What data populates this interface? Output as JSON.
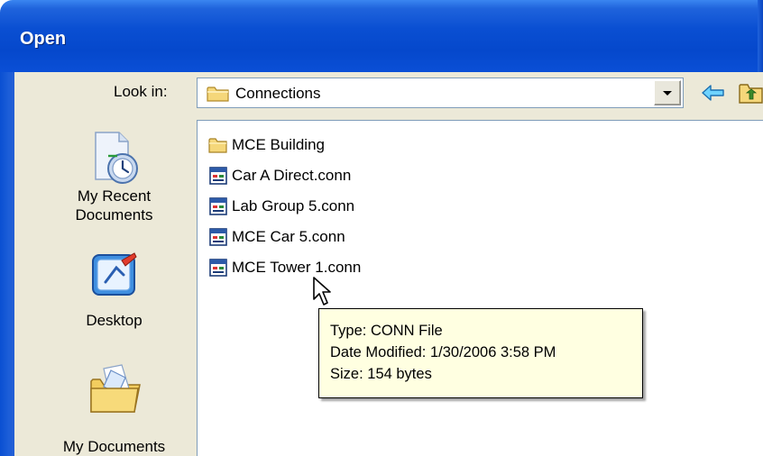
{
  "window": {
    "title": "Open"
  },
  "toolbar": {
    "look_in_label": "Look in:",
    "look_in_value": "Connections",
    "look_in_icon": "folder-icon",
    "back_icon": "back-arrow-icon",
    "up_icon": "up-folder-icon"
  },
  "places": [
    {
      "label_line1": "My Recent",
      "label_line2": "Documents",
      "icon": "recent-documents-icon"
    },
    {
      "label_line1": "Desktop",
      "icon": "desktop-icon"
    },
    {
      "label_line1": "My Documents",
      "icon": "my-documents-icon"
    }
  ],
  "files": [
    {
      "name": "MCE Building",
      "type": "folder"
    },
    {
      "name": "Car A Direct.conn",
      "type": "file"
    },
    {
      "name": "Lab Group 5.conn",
      "type": "file"
    },
    {
      "name": "MCE Car 5.conn",
      "type": "file"
    },
    {
      "name": "MCE Tower 1.conn",
      "type": "file"
    }
  ],
  "tooltip": {
    "type_line": "Type: CONN File",
    "date_line": "Date Modified: 1/30/2006 3:58 PM",
    "size_line": "Size: 154 bytes"
  },
  "colors": {
    "title_bar": "#0a4fd2",
    "dialog_bg": "#ece9d8",
    "tooltip_bg": "#ffffe1",
    "field_border": "#7f9db9"
  }
}
